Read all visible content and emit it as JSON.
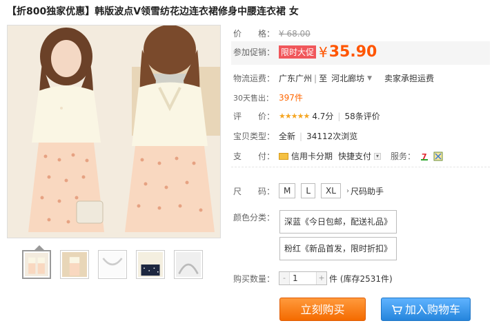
{
  "title": "【折800独家优惠】韩版波点V领雪纺花边连衣裙修身中腰连衣裙 女",
  "price": {
    "label": "价　　格：",
    "original": "¥ 68.00"
  },
  "promo": {
    "label": "参加促销：",
    "tag": "限时大促",
    "yen": "¥",
    "amount": "35.90"
  },
  "shipping": {
    "label": "物流运费：",
    "from": "广东广州",
    "sep": "|",
    "to_prefix": "至",
    "to": "河北廊坊",
    "fee": "卖家承担运费"
  },
  "sales": {
    "label": "30天售出：",
    "count": "397件"
  },
  "rating": {
    "label": "评　　价：",
    "stars": "★★★★★",
    "score": "4.7分",
    "sep": "|",
    "reviews": "58条评价"
  },
  "type": {
    "label": "宝贝类型：",
    "value": "全新",
    "sep": "|",
    "views": "34112次浏览"
  },
  "payment": {
    "label": "支　　付：",
    "credit": "信用卡分期",
    "quick": "快捷支付",
    "service_label": "服务：",
    "svc1_icon": "seven-day-return-icon",
    "svc2_icon": "guarantee-icon"
  },
  "size": {
    "label": "尺　　码：",
    "options": [
      "M",
      "L",
      "XL"
    ],
    "helper": "尺码助手"
  },
  "color": {
    "label": "颜色分类：",
    "options": [
      "深蓝《今日包邮，配送礼品》",
      "粉红《新品首发，限时折扣》"
    ]
  },
  "quantity": {
    "label": "购买数量：",
    "minus": "-",
    "value": "1",
    "plus": "+",
    "stock": "件 (库存2531件)"
  },
  "actions": {
    "buy": "立刻购买",
    "cart": "加入购物车",
    "cart_icon": "shopping-cart-icon"
  },
  "colors": {
    "accent": "#ff5500",
    "buy": "#f46b00",
    "cart": "#2585dc"
  }
}
